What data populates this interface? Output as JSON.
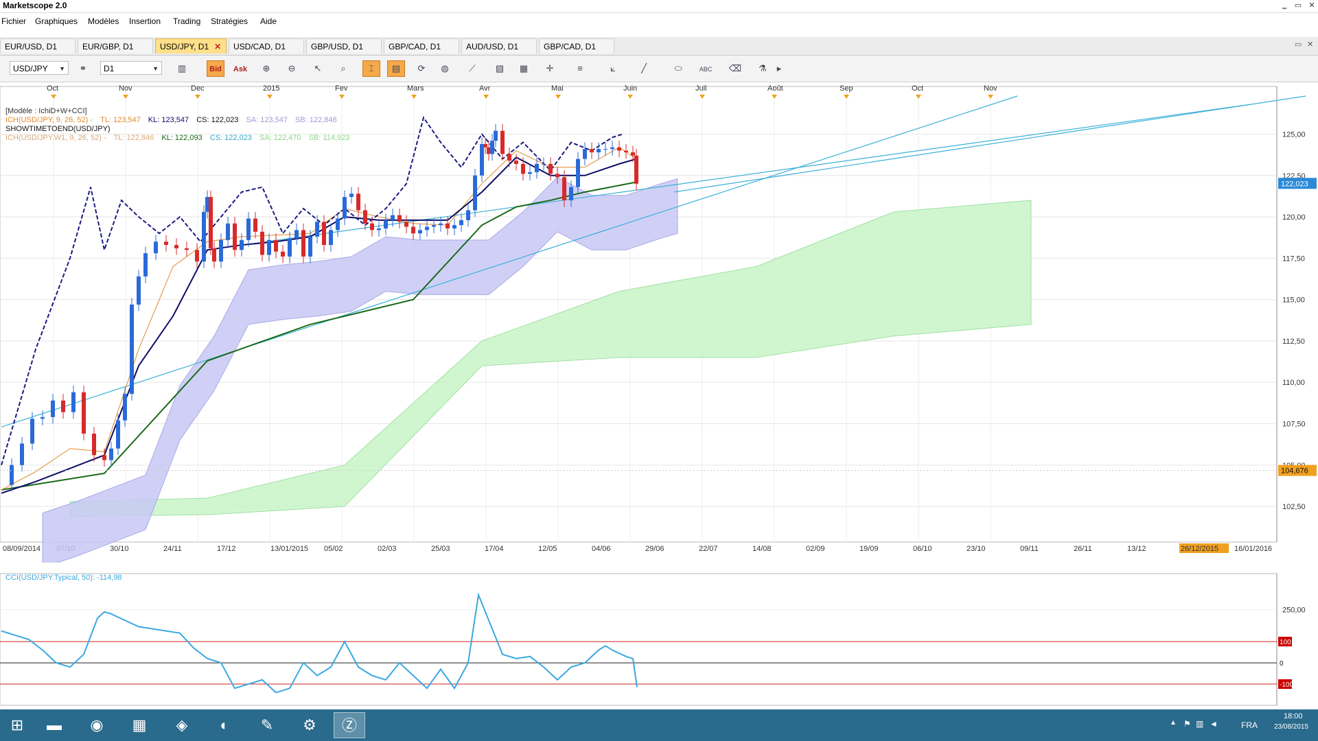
{
  "app": {
    "title": "Marketscope 2.0"
  },
  "window_controls": {
    "minimize": "‗",
    "restore": "▭",
    "close": "✕"
  },
  "menu": [
    "Fichier",
    "Graphiques",
    "Modèles",
    "Insertion",
    "Trading",
    "Stratégies",
    "Aide"
  ],
  "tabs": [
    {
      "label": "EUR/USD, D1",
      "active": false
    },
    {
      "label": "EUR/GBP, D1",
      "active": false
    },
    {
      "label": "USD/JPY, D1",
      "active": true
    },
    {
      "label": "USD/CAD, D1",
      "active": false
    },
    {
      "label": "GBP/USD, D1",
      "active": false
    },
    {
      "label": "GBP/CAD, D1",
      "active": false
    },
    {
      "label": "AUD/USD, D1",
      "active": false
    },
    {
      "label": "GBP/CAD, D1",
      "active": false
    }
  ],
  "toolbar": {
    "instrument": "USD/JPY",
    "timeframe": "D1",
    "bid_label": "Bid",
    "ask_label": "Ask",
    "text_tool": "ABC"
  },
  "legend": {
    "model": "[Modèle : IchiD+W+CCI]",
    "ich_daily_prefix": "ICH(USD/JPY, 9, 26, 52) -",
    "ich_daily_tl": "TL: 123,547",
    "ich_daily_kl": "KL: 123,547",
    "ich_daily_cs": "CS: 122,023",
    "ich_daily_sa": "SA: 123,547",
    "ich_daily_sb": "SB: 122,846",
    "showtime": "SHOWTIMETOEND(USD/JPY)",
    "ich_weekly_prefix": "ICH(USD/JPY.W1, 9, 26, 52) -",
    "ich_weekly_tl": "TL: 122,846",
    "ich_weekly_kl": "KL: 122,093",
    "ich_weekly_cs": "CS: 122,023",
    "ich_weekly_sa": "SA: 122,470",
    "ich_weekly_sb": "SB: 114,923",
    "cci": "CCI(USD/JPY.Typical, 50): -114,98"
  },
  "colors": {
    "tenkan_daily": "#e08a2a",
    "kijun_daily": "#0c0c66",
    "chikou": "#1a1a80",
    "kumo_daily": "#c8c8f4",
    "kumo_weekly": "#c8f4c8",
    "kijun_weekly": "#1a6a1a",
    "channel": "#3ab0d8",
    "candle_up": "#2a6ad8",
    "candle_down": "#d82a2a",
    "cci_line": "#3aa8e0",
    "cci_level": "#cc2222",
    "price_tag": "#2a8ad8",
    "marker_tag": "#f0a020"
  },
  "chart_data": {
    "type": "candlestick",
    "title": "",
    "symbol": "USD/JPY",
    "timeframe": "D1",
    "price_axis": [
      "125,00",
      "122,50",
      "120,00",
      "117,50",
      "115,00",
      "112,50",
      "110,00",
      "107,50",
      "105,00",
      "102,50"
    ],
    "price_range": [
      101.8,
      127.3
    ],
    "current_price": "122,023",
    "marker_price": "104,676",
    "months_top": [
      "Oct",
      "Nov",
      "Dec",
      "2015",
      "Fev",
      "Mars",
      "Avr",
      "Mai",
      "Juin",
      "Juil",
      "Août",
      "Sep",
      "Oct",
      "Nov"
    ],
    "dates_bottom": [
      "08/09/2014",
      "07/10",
      "30/10",
      "24/11",
      "17/12",
      "13/01/2015",
      "05/02",
      "02/03",
      "25/03",
      "17/04",
      "12/05",
      "04/06",
      "29/06",
      "22/07",
      "14/08",
      "02/09",
      "19/09",
      "06/10",
      "23/10",
      "09/11",
      "26/11",
      "13/12",
      "26/12/2015",
      "16/01/2016"
    ],
    "highlighted_date": "26/12/2015",
    "series": [
      {
        "name": "price_close",
        "x": [
          0,
          15,
          30,
          45,
          60,
          75,
          90,
          105,
          120,
          135,
          150,
          160,
          170,
          180,
          190,
          200,
          210,
          225,
          240,
          255,
          270,
          285,
          295,
          300,
          305,
          310,
          320,
          330,
          340,
          350,
          360,
          370,
          380,
          390,
          400,
          410,
          420,
          430,
          440,
          450,
          460,
          470,
          480,
          490,
          500,
          510,
          520,
          530,
          540,
          550,
          560,
          570,
          580,
          590,
          600,
          610,
          620,
          630,
          640,
          650,
          660,
          670,
          680,
          690,
          700,
          705,
          710,
          715,
          720,
          730,
          740,
          750,
          760,
          770,
          780,
          790,
          800,
          810,
          820,
          830,
          840,
          850,
          860,
          870,
          880,
          890,
          900,
          910,
          920,
          925
        ],
        "y": [
          103.8,
          105.0,
          106.3,
          107.8,
          107.9,
          108.9,
          108.2,
          109.4,
          106.9,
          105.6,
          105.3,
          106.0,
          107.7,
          109.3,
          114.7,
          116.4,
          117.8,
          118.5,
          118.3,
          118.1,
          118.0,
          117.3,
          120.3,
          121.2,
          118.1,
          117.3,
          118.6,
          119.6,
          118.0,
          118.6,
          119.9,
          119.1,
          117.7,
          118.6,
          117.9,
          117.6,
          118.7,
          119.2,
          117.6,
          118.8,
          119.7,
          118.3,
          119.2,
          119.9,
          121.2,
          121.4,
          120.4,
          119.6,
          119.2,
          119.3,
          119.8,
          120.1,
          119.7,
          119.4,
          119.0,
          119.2,
          119.4,
          119.5,
          119.6,
          119.3,
          119.5,
          119.8,
          120.4,
          122.5,
          124.4,
          124.2,
          123.8,
          124.6,
          125.2,
          123.8,
          123.4,
          123.2,
          122.6,
          122.7,
          123.2,
          123.2,
          122.6,
          122.4,
          121.0,
          121.8,
          123.5,
          124.1,
          123.9,
          124.1,
          124.1,
          124.2,
          124.0,
          123.9,
          123.7,
          122.0
        ]
      },
      {
        "name": "tenkan_daily",
        "x": [
          0,
          50,
          100,
          150,
          200,
          250,
          300,
          350,
          400,
          450,
          500,
          550,
          600,
          650,
          700,
          750,
          800,
          850,
          900,
          925
        ],
        "y": [
          103.5,
          104.6,
          106.0,
          105.8,
          112.0,
          117.0,
          118.5,
          118.8,
          118.9,
          119.0,
          120.5,
          120.0,
          119.6,
          119.5,
          122.0,
          124.0,
          123.0,
          123.0,
          124.2,
          123.5
        ]
      },
      {
        "name": "kijun_daily",
        "x": [
          0,
          50,
          100,
          150,
          200,
          250,
          300,
          350,
          400,
          450,
          500,
          550,
          600,
          650,
          700,
          750,
          800,
          850,
          900,
          925
        ],
        "y": [
          103.3,
          104.0,
          104.8,
          105.6,
          111.0,
          114.0,
          118.0,
          118.3,
          118.5,
          118.8,
          120.0,
          119.8,
          119.8,
          119.8,
          121.5,
          123.6,
          122.5,
          122.5,
          123.2,
          123.5
        ]
      },
      {
        "name": "chikou",
        "x": [
          0,
          50,
          100,
          130,
          150,
          175,
          200,
          230,
          260,
          290,
          320,
          350,
          380,
          410,
          440,
          470,
          500,
          530,
          560,
          590,
          615,
          640,
          670,
          700,
          730,
          760,
          800,
          830,
          860,
          890,
          905
        ],
        "y": [
          105.0,
          112.0,
          117.5,
          121.8,
          118.0,
          121.0,
          120.0,
          119.0,
          120.0,
          118.5,
          120.0,
          121.5,
          121.8,
          119.0,
          120.5,
          119.5,
          120.5,
          119.5,
          120.5,
          122.0,
          126.0,
          124.5,
          123.0,
          125.0,
          123.5,
          124.5,
          122.8,
          124.5,
          124.0,
          124.8,
          125.0
        ]
      },
      {
        "name": "kijun_weekly",
        "x": [
          0,
          150,
          300,
          450,
          600,
          700,
          750,
          800,
          850,
          900,
          925
        ],
        "y": [
          103.5,
          104.5,
          111.3,
          113.5,
          115.0,
          119.5,
          120.6,
          121.0,
          121.5,
          121.9,
          122.1
        ]
      },
      {
        "name": "kumo_weekly_upper",
        "x": [
          100,
          300,
          500,
          700,
          900,
          1100,
          1300,
          1500
        ],
        "y": [
          102.8,
          103.0,
          105.0,
          112.5,
          115.5,
          117.0,
          120.3,
          121.0
        ]
      },
      {
        "name": "kumo_weekly_lower",
        "x": [
          100,
          300,
          500,
          700,
          900,
          1100,
          1300,
          1500
        ],
        "y": [
          101.9,
          102.0,
          102.5,
          111.0,
          111.5,
          111.5,
          112.8,
          113.5
        ]
      },
      {
        "name": "cci",
        "x": [
          0,
          20,
          40,
          60,
          80,
          100,
          120,
          140,
          150,
          160,
          180,
          200,
          220,
          240,
          260,
          280,
          300,
          320,
          340,
          360,
          380,
          400,
          420,
          440,
          460,
          480,
          500,
          520,
          540,
          560,
          580,
          600,
          620,
          640,
          660,
          680,
          695,
          710,
          730,
          750,
          770,
          790,
          810,
          830,
          850,
          870,
          880,
          890,
          910,
          920,
          926
        ],
        "y": [
          150,
          130,
          110,
          60,
          0,
          -20,
          40,
          210,
          240,
          230,
          200,
          170,
          160,
          150,
          140,
          70,
          20,
          0,
          -120,
          -100,
          -80,
          -140,
          -120,
          0,
          -60,
          -20,
          100,
          -20,
          -60,
          -80,
          0,
          -60,
          -120,
          -30,
          -120,
          0,
          320,
          200,
          40,
          20,
          30,
          -20,
          -80,
          -20,
          0,
          60,
          80,
          60,
          30,
          20,
          -115
        ]
      }
    ],
    "cci_axis": [
      "250,00"
    ],
    "cci_levels": [
      "100",
      "0",
      "-100"
    ]
  },
  "taskbar": {
    "icons": [
      "windows-start",
      "file-explorer",
      "firefox",
      "calculator",
      "app-diamond",
      "nvidia",
      "paint",
      "steam",
      "marketscope"
    ],
    "language": "FRA",
    "time": "18:00",
    "date": "23/08/2015"
  }
}
